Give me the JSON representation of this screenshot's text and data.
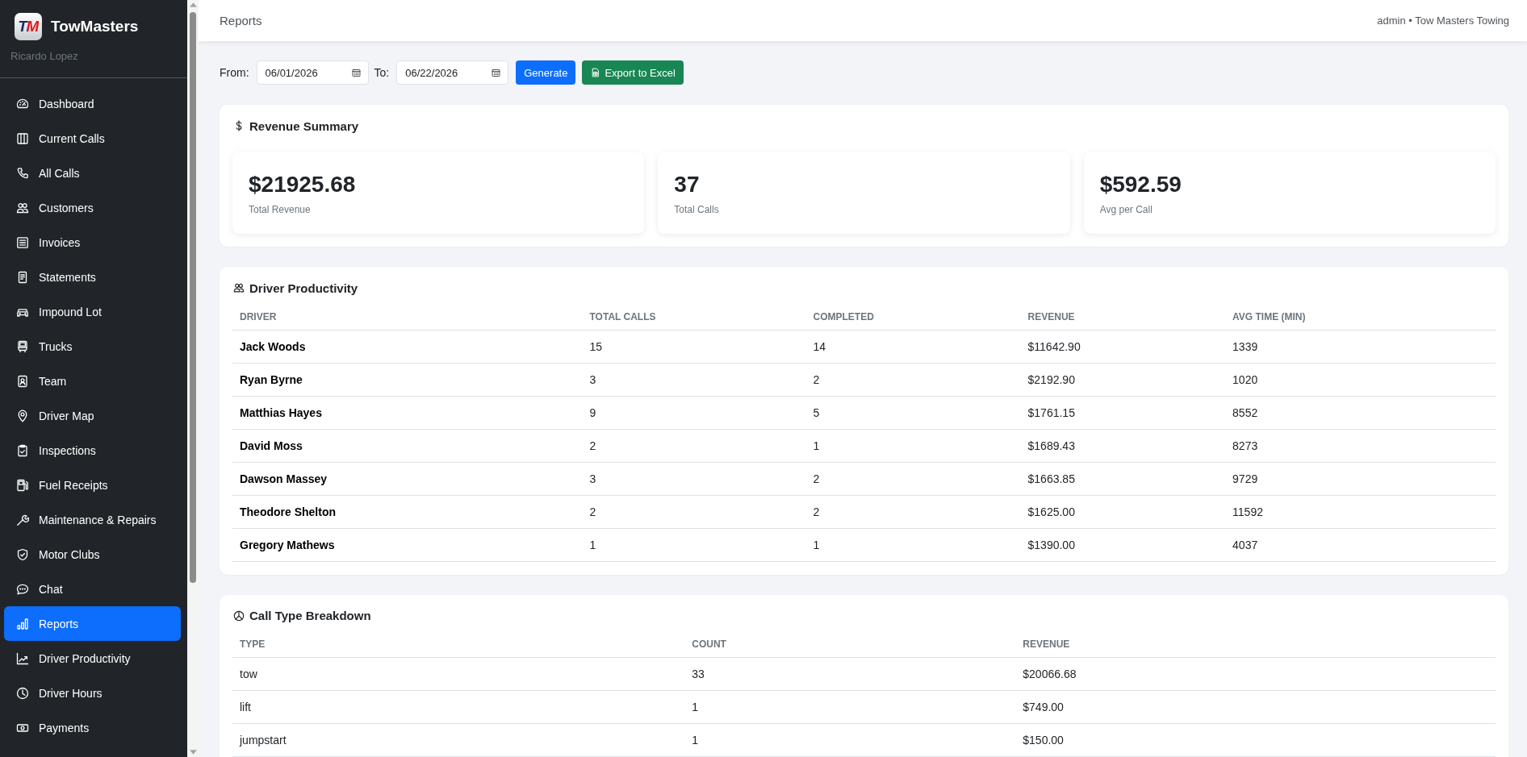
{
  "sidebar": {
    "logo_text": "TM",
    "brand": "TowMasters",
    "user": "Ricardo Lopez",
    "items": [
      {
        "label": "Dashboard",
        "selected": false
      },
      {
        "label": "Current Calls",
        "selected": false
      },
      {
        "label": "All Calls",
        "selected": false
      },
      {
        "label": "Customers",
        "selected": false
      },
      {
        "label": "Invoices",
        "selected": false
      },
      {
        "label": "Statements",
        "selected": false
      },
      {
        "label": "Impound Lot",
        "selected": false
      },
      {
        "label": "Trucks",
        "selected": false
      },
      {
        "label": "Team",
        "selected": false
      },
      {
        "label": "Driver Map",
        "selected": false
      },
      {
        "label": "Inspections",
        "selected": false
      },
      {
        "label": "Fuel Receipts",
        "selected": false
      },
      {
        "label": "Maintenance & Repairs",
        "selected": false
      },
      {
        "label": "Motor Clubs",
        "selected": false
      },
      {
        "label": "Chat",
        "selected": false
      },
      {
        "label": "Reports",
        "selected": true
      },
      {
        "label": "Driver Productivity",
        "selected": false
      },
      {
        "label": "Driver Hours",
        "selected": false
      },
      {
        "label": "Payments",
        "selected": false
      }
    ]
  },
  "header": {
    "title": "Reports",
    "account": "admin • Tow Masters Towing"
  },
  "filters": {
    "fields": [
      {
        "label": "From:",
        "value": "06/01/2026"
      },
      {
        "label": "To:",
        "value": "06/22/2026"
      }
    ],
    "buttons": [
      {
        "label": "Generate",
        "kind": "primary"
      },
      {
        "label": "Export to Excel",
        "kind": "export"
      }
    ]
  },
  "revenue_summary": {
    "title": "Revenue Summary",
    "stats": [
      {
        "value": "$21925.68",
        "label": "Total Revenue"
      },
      {
        "value": "37",
        "label": "Total Calls"
      },
      {
        "value": "$592.59",
        "label": "Avg per Call"
      }
    ]
  },
  "driver_productivity": {
    "title": "Driver Productivity",
    "columns": [
      "DRIVER",
      "TOTAL CALLS",
      "COMPLETED",
      "REVENUE",
      "AVG TIME (MIN)"
    ],
    "rows": [
      [
        "Jack Woods",
        "15",
        "14",
        "$11642.90",
        "1339"
      ],
      [
        "Ryan Byrne",
        "3",
        "2",
        "$2192.90",
        "1020"
      ],
      [
        "Matthias Hayes",
        "9",
        "5",
        "$1761.15",
        "8552"
      ],
      [
        "David Moss",
        "2",
        "1",
        "$1689.43",
        "8273"
      ],
      [
        "Dawson Massey",
        "3",
        "2",
        "$1663.85",
        "9729"
      ],
      [
        "Theodore Shelton",
        "2",
        "2",
        "$1625.00",
        "11592"
      ],
      [
        "Gregory Mathews",
        "1",
        "1",
        "$1390.00",
        "4037"
      ]
    ]
  },
  "call_type_breakdown": {
    "title": "Call Type Breakdown",
    "columns": [
      "TYPE",
      "COUNT",
      "REVENUE"
    ],
    "rows": [
      [
        "tow",
        "33",
        "$20066.68"
      ],
      [
        "lift",
        "1",
        "$749.00"
      ],
      [
        "jumpstart",
        "1",
        "$150.00"
      ]
    ]
  }
}
